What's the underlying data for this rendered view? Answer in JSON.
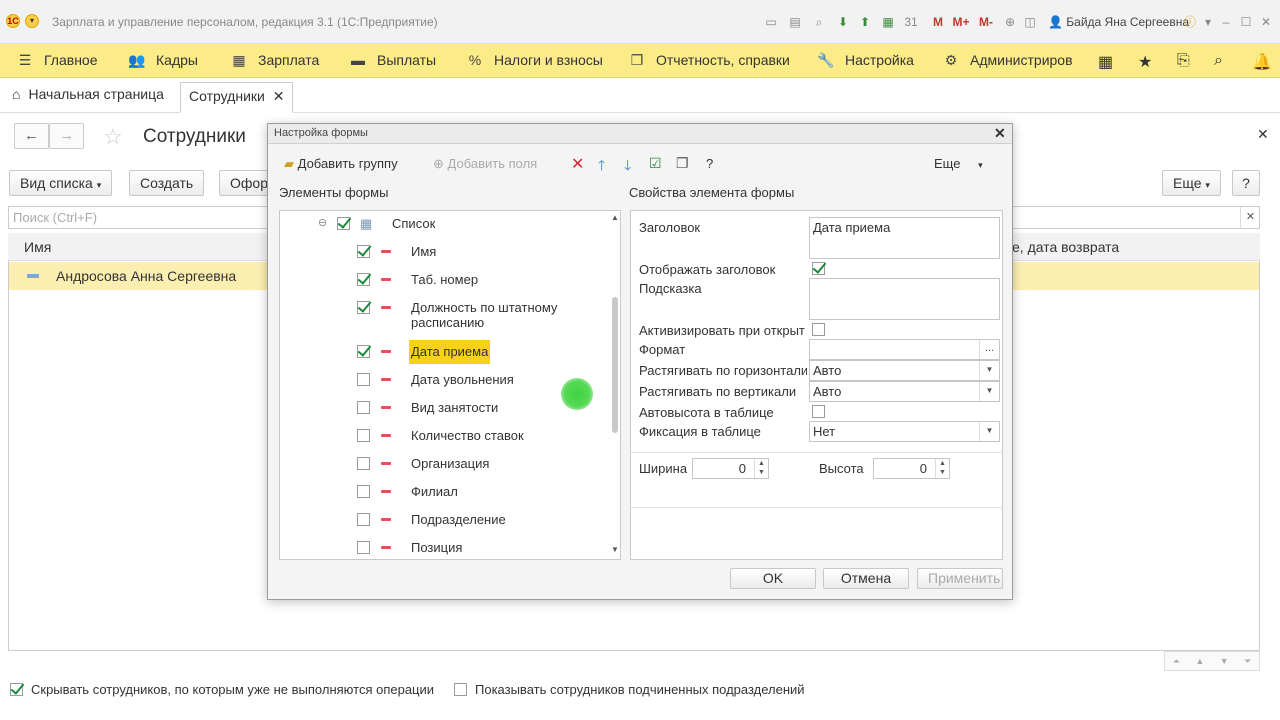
{
  "window": {
    "title": "Зарплата и управление персоналом, редакция 3.1  (1С:Предприятие)",
    "user": "Байда Яна Сергеевна"
  },
  "menu": [
    {
      "label": "Главное",
      "icon": "hamburger-icon"
    },
    {
      "label": "Кадры",
      "icon": "people-icon"
    },
    {
      "label": "Зарплата",
      "icon": "calculator-icon"
    },
    {
      "label": "Выплаты",
      "icon": "money-icon"
    },
    {
      "label": "Налоги и взносы",
      "icon": "percent-icon"
    },
    {
      "label": "Отчетность, справки",
      "icon": "reports-icon"
    },
    {
      "label": "Настройка",
      "icon": "wrench-icon"
    },
    {
      "label": "Администриров",
      "icon": "gear-icon"
    }
  ],
  "tabs": {
    "home": "Начальная страница",
    "employees": "Сотрудники"
  },
  "form": {
    "title": "Сотрудники",
    "buttons": {
      "view": "Вид списка",
      "create": "Создать",
      "format": "Офор",
      "more": "Еще",
      "help": "?"
    },
    "search_placeholder": "Поиск (Ctrl+F)",
    "columns": {
      "name": "Имя",
      "right_partial": "е, дата возврата"
    },
    "rows": [
      {
        "name": "Андросова Анна Сергеевна"
      }
    ],
    "bottom": {
      "hide_label": "Скрывать сотрудников, по которым уже не выполняются операции",
      "hide_checked": true,
      "show_sub_label": "Показывать сотрудников подчиненных подразделений",
      "show_sub_checked": false
    }
  },
  "dialog": {
    "title": "Настройка формы",
    "toolbar": {
      "add_group": "Добавить группу",
      "add_fields": "Добавить поля",
      "help": "?",
      "more": "Еще"
    },
    "left_title": "Элементы формы",
    "right_title": "Свойства элемента формы",
    "tree_root": {
      "label": "Список",
      "checked": true
    },
    "tree_items": [
      {
        "label": "Имя",
        "checked": true
      },
      {
        "label": "Таб. номер",
        "checked": true
      },
      {
        "label": "Должность по штатному расписанию",
        "checked": true
      },
      {
        "label": "Дата приема",
        "checked": true,
        "selected": true
      },
      {
        "label": "Дата увольнения",
        "checked": false
      },
      {
        "label": "Вид занятости",
        "checked": false
      },
      {
        "label": "Количество ставок",
        "checked": false
      },
      {
        "label": "Организация",
        "checked": false
      },
      {
        "label": "Филиал",
        "checked": false
      },
      {
        "label": "Подразделение",
        "checked": false
      },
      {
        "label": "Позиция",
        "checked": false
      }
    ],
    "props": {
      "header_label": "Заголовок",
      "header_value": "Дата приема",
      "show_header_label": "Отображать заголовок",
      "show_header_checked": true,
      "hint_label": "Подсказка",
      "hint_value": "",
      "activate_label": "Активизировать при открыт",
      "activate_checked": false,
      "format_label": "Формат",
      "format_value": "",
      "format_button": "...",
      "stretch_h_label": "Растягивать по горизонтали",
      "stretch_h_value": "Авто",
      "stretch_v_label": "Растягивать по вертикали",
      "stretch_v_value": "Авто",
      "autoheight_label": "Автовысота в таблице",
      "autoheight_checked": false,
      "fix_label": "Фиксация в таблице",
      "fix_value": "Нет",
      "width_label": "Ширина",
      "width_value": "0",
      "height_label": "Высота",
      "height_value": "0"
    },
    "buttons": {
      "ok": "OK",
      "cancel": "Отмена",
      "apply": "Применить"
    }
  },
  "colors": {
    "menu_bg": "#fbec88",
    "selected_row": "#fbeeb0",
    "selected_item": "#f7d117",
    "check_green": "#1a8a3a",
    "remove_red": "#e0505a"
  }
}
